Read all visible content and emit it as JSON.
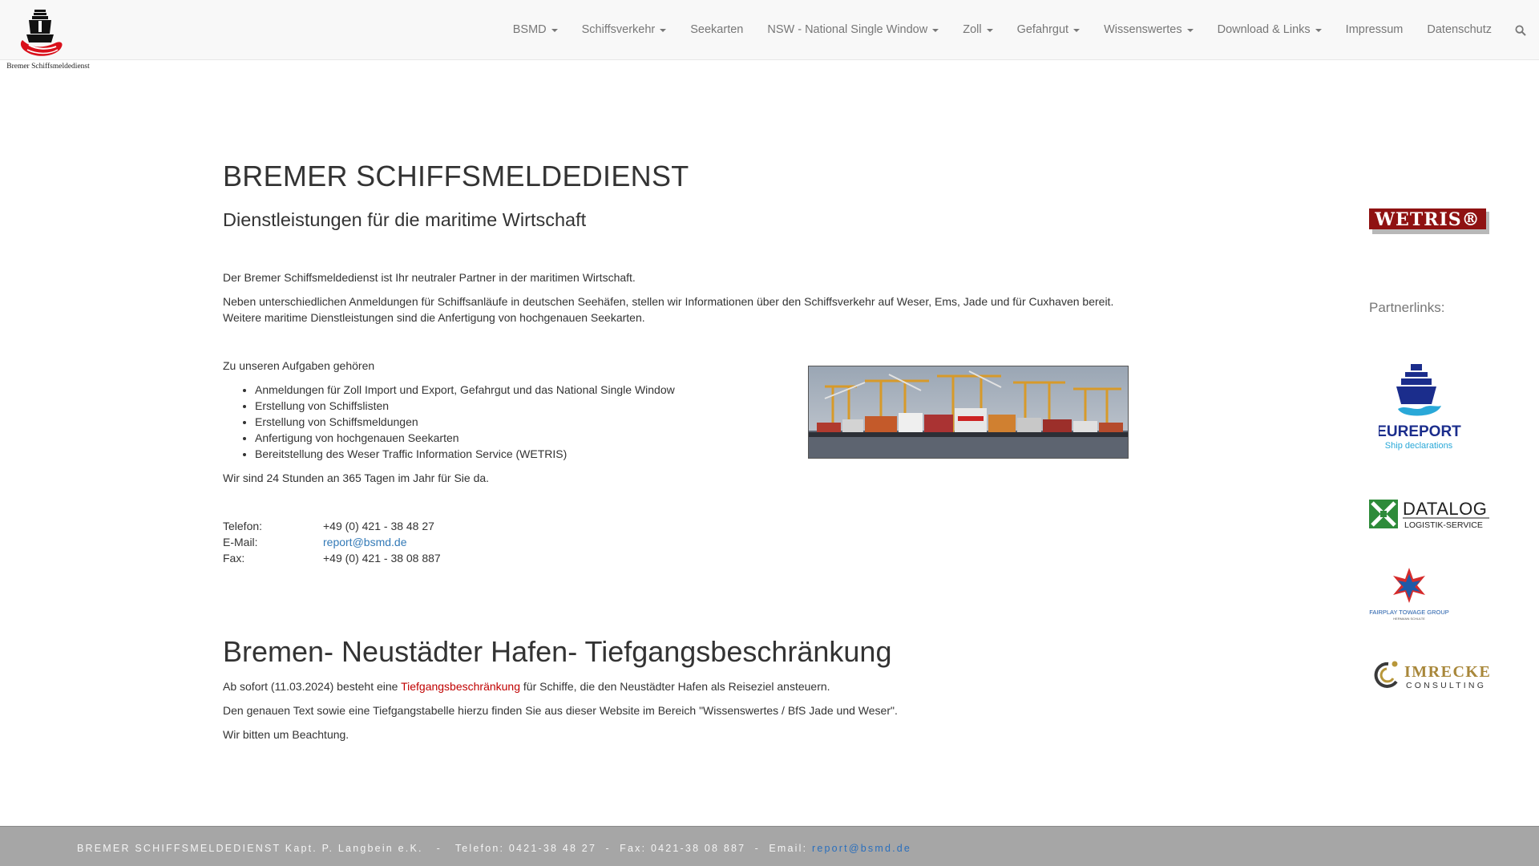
{
  "brand": {
    "logo_text": "Bremer Schiffsmeldedienst"
  },
  "nav": {
    "items": [
      {
        "label": "BSMD",
        "dropdown": true
      },
      {
        "label": "Schiffsverkehr",
        "dropdown": true
      },
      {
        "label": "Seekarten",
        "dropdown": false
      },
      {
        "label": "NSW - National Single Window",
        "dropdown": true
      },
      {
        "label": "Zoll",
        "dropdown": true
      },
      {
        "label": "Gefahrgut",
        "dropdown": true
      },
      {
        "label": "Wissenswertes",
        "dropdown": true
      },
      {
        "label": "Download & Links",
        "dropdown": true
      },
      {
        "label": "Impressum",
        "dropdown": false
      },
      {
        "label": "Datenschutz",
        "dropdown": false
      }
    ],
    "search_icon": "search-icon"
  },
  "main": {
    "title": "BREMER SCHIFFSMELDEDIENST",
    "subtitle": "Dienstleistungen für die maritime Wirtschaft",
    "intro1": "Der Bremer Schiffsmeldedienst ist Ihr neutraler Partner in der maritimen Wirtschaft.",
    "intro2": "Neben unterschiedlichen Anmeldungen für Schiffsanläufe in deutschen Seehäfen, stellen wir Informationen über den Schiffsverkehr auf Weser, Ems, Jade und für Cuxhaven bereit. Weitere maritime Dienstleistungen sind die Anfertigung von hochgenauen Seekarten.",
    "tasks_title": "Zu unseren Aufgaben gehören",
    "tasks": [
      "Anmeldungen für Zoll Import und Export, Gefahrgut und das National Single Window",
      "Erstellung von Schiffslisten",
      "Erstellung von Schiffsmeldungen",
      "Anfertigung von hochgenauen Seekarten",
      "Bereitstellung des Weser Traffic Information Service (WETRIS)"
    ],
    "hours": "Wir sind 24 Stunden an 365 Tagen im Jahr für Sie da.",
    "contact": {
      "phone_label": "Telefon:",
      "phone": "+49 (0) 421 - 38 48 27",
      "email_label": "E-Mail:",
      "email": "report@bsmd.de",
      "fax_label": "Fax:",
      "fax": "+49 (0) 421 - 38 08 887"
    }
  },
  "news": {
    "title": "Bremen- Neustädter Hafen- Tiefgangsbeschränkung",
    "p1_before": "Ab sofort (11.03.2024) besteht eine ",
    "p1_link": "Tiefgangsbeschränkung",
    "p1_after": " für Schiffe, die den Neustädter Hafen als Reiseziel ansteuern.",
    "p2": "Den genauen Text sowie eine Tiefgangstabelle hierzu finden Sie aus dieser Website im Bereich \"Wissenswertes / BfS Jade und Weser\".",
    "p3": "Wir bitten um Beachtung."
  },
  "sidebar": {
    "wetris_logo": "WETRIS®",
    "partner_title": "Partnerlinks:",
    "partners": {
      "eureport": {
        "name": "EUREPORT",
        "tagline": "Ship declarations"
      },
      "datalog": {
        "name": "DATALOG",
        "tagline": "LOGISTIK-SERVICE"
      },
      "fairplay": {
        "name": "FAIRPLAY TOWAGE GROUP",
        "tagline": "HERMANN SCHULTE"
      },
      "imrecke": {
        "name": "IMRECKE",
        "tagline": "CONSULTING"
      }
    }
  },
  "footer": {
    "text": "BREMER SCHIFFSMELDEDIENST Kapt. P. Langbein e.K.   -   Telefon: 0421-38 48 27  -  Fax: 0421-38 08 887  -  Email: ",
    "email": "report@bsmd.de"
  },
  "colors": {
    "link": "#337ab7",
    "highlight": "#c00000",
    "footer_bg": "#a6a6a6",
    "navbar_bg": "#f8f8f8"
  }
}
